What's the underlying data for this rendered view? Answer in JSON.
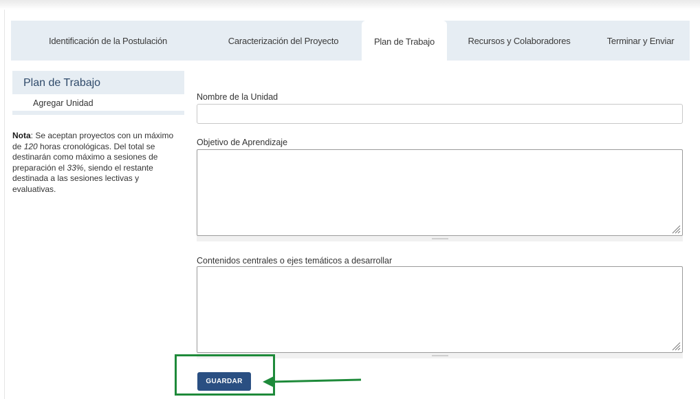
{
  "tabs": [
    {
      "label": "Identificación de la Postulación",
      "active": false
    },
    {
      "label": "Caracterización del Proyecto",
      "active": false
    },
    {
      "label": "Plan de Trabajo",
      "active": true
    },
    {
      "label": "Recursos y Colaboradores",
      "active": false
    },
    {
      "label": "Terminar y Enviar",
      "active": false
    }
  ],
  "sidebar": {
    "title": "Plan de Trabajo",
    "items": [
      {
        "label": "Agregar Unidad"
      }
    ],
    "note": {
      "bold": "Nota",
      "p1": ": Se aceptan proyectos con un máximo de ",
      "hours": "120",
      "p2": " horas cronológicas. Del total se destinarán como máximo a sesiones de preparación el ",
      "percent": "33%",
      "p3": ", siendo el restante destinada a las sesiones lectivas y evaluativas."
    }
  },
  "form": {
    "unit_name": {
      "label": "Nombre de la Unidad",
      "value": ""
    },
    "objective": {
      "label": "Objetivo de Aprendizaje",
      "value": ""
    },
    "contents": {
      "label": "Contenidos centrales o ejes temáticos a desarrollar",
      "value": ""
    }
  },
  "actions": {
    "save_label": "GUARDAR"
  },
  "colors": {
    "tab_bar": "#e6edf3",
    "button": "#2a4f82",
    "highlight": "#1e8a3a"
  }
}
